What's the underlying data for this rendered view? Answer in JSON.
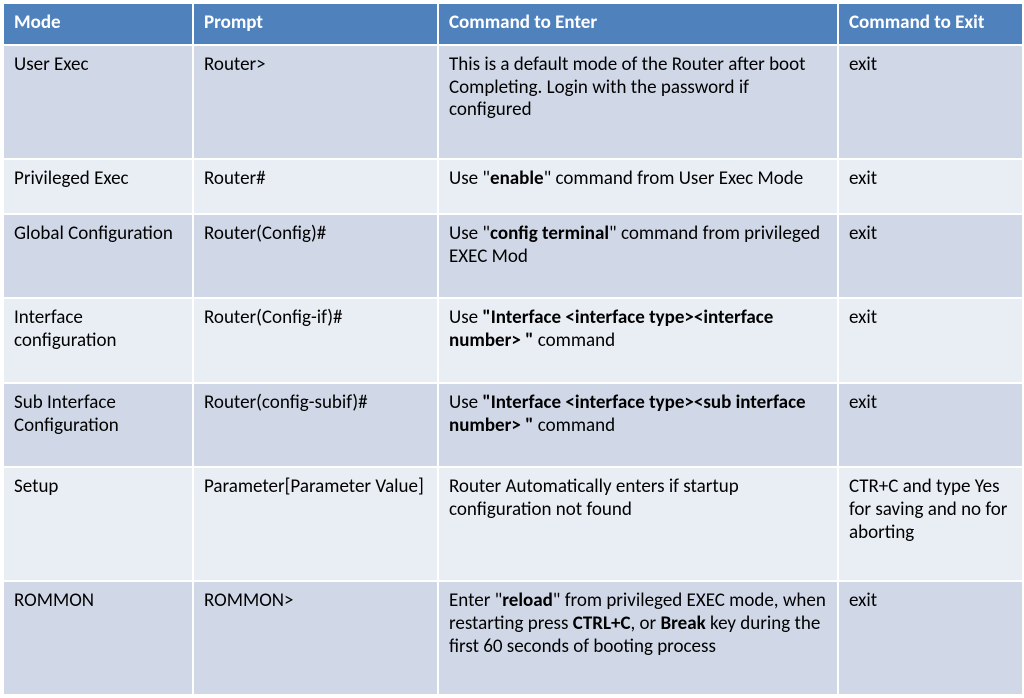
{
  "headers": {
    "mode": "Mode",
    "prompt": "Prompt",
    "enter": "Command to Enter",
    "exit": "Command to Exit"
  },
  "rows": [
    {
      "mode": "User Exec",
      "prompt": "Router>",
      "enter_plain": "This is a default mode of the Router after boot Completing. Login with the password if configured",
      "exit": "exit"
    },
    {
      "mode": "Privileged Exec",
      "prompt": "Router#",
      "enter_pre": "Use \"",
      "enter_bold": "enable",
      "enter_post": "\" command from User Exec Mode",
      "exit": "exit"
    },
    {
      "mode": "Global Configuration",
      "prompt": "Router(Config)#",
      "enter_pre": "Use \"",
      "enter_bold": "config terminal",
      "enter_post": "\" command from privileged EXEC Mod",
      "exit": "exit"
    },
    {
      "mode": "Interface configuration",
      "prompt": "Router(Config-if)#",
      "enter_pre": "Use ",
      "enter_bold": "\"Interface <interface type><interface number> \"",
      "enter_post": " command",
      "exit": "exit"
    },
    {
      "mode": "Sub Interface Configuration",
      "prompt": "Router(config-subif)#",
      "enter_pre": "Use ",
      "enter_bold": "\"Interface <interface type><sub interface number> \"",
      "enter_post": " command",
      "exit": "exit"
    },
    {
      "mode": "Setup",
      "prompt": "Parameter[Parameter Value]",
      "enter_plain": "Router Automatically enters if startup configuration not found",
      "exit": "CTR+C and type Yes for saving and no for aborting"
    },
    {
      "mode": "ROMMON",
      "prompt": "ROMMON>",
      "enter_p1": "Enter \"",
      "enter_b1": "reload",
      "enter_p2": "\" from privileged EXEC mode, when restarting press ",
      "enter_b2": "CTRL+C",
      "enter_p3": ", or ",
      "enter_b3": "Break",
      "enter_p4": " key during the first 60 seconds of booting process",
      "exit": "exit"
    }
  ]
}
